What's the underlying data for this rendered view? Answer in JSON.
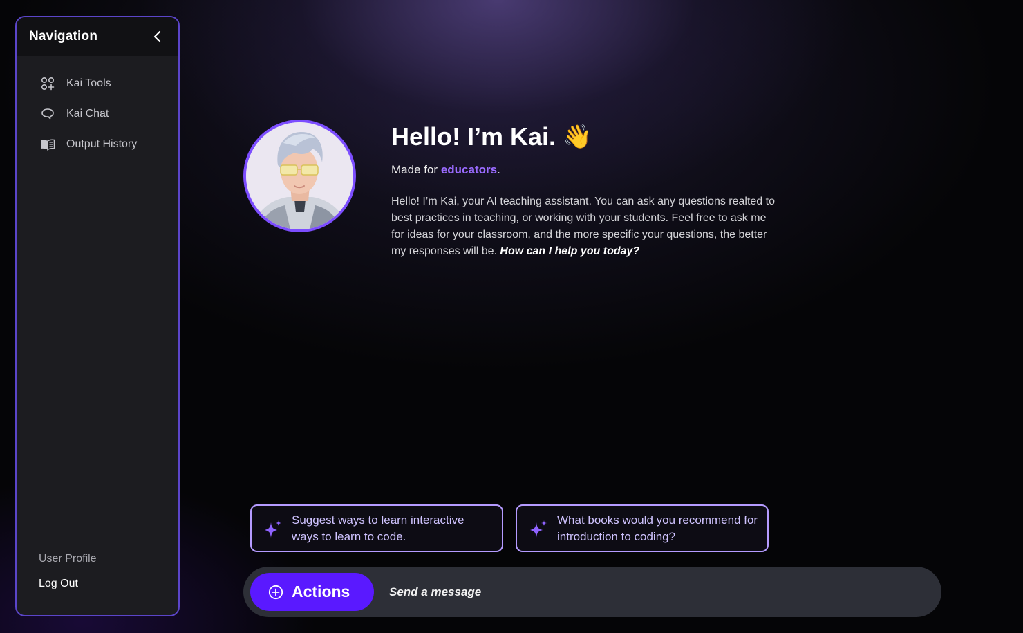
{
  "nav": {
    "title": "Navigation",
    "items": [
      {
        "label": "Kai Tools",
        "icon": "grid-plus-icon"
      },
      {
        "label": "Kai Chat",
        "icon": "chat-bubble-icon"
      },
      {
        "label": "Output History",
        "icon": "open-book-icon"
      }
    ],
    "footer": {
      "user_profile": "User Profile",
      "log_out": "Log Out"
    }
  },
  "intro": {
    "greeting": "Hello! I’m Kai.",
    "wave": "👋",
    "made_for_prefix": "Made for ",
    "made_for_accent": "educators",
    "made_for_suffix": ".",
    "body": "Hello! I’m Kai, your AI teaching assistant. You can ask any questions realted to best practices in teaching, or working with your students. Feel free to ask me for ideas for your classroom, and the more specific your questions, the better my responses will be. ",
    "question": "How can I help you today?"
  },
  "suggestions": [
    {
      "text": "Suggest ways to learn interactive ways to learn to code."
    },
    {
      "text": "What books would you recommend for introduction to coding?"
    }
  ],
  "chat": {
    "actions_label": "Actions",
    "placeholder": "Send a message"
  },
  "colors": {
    "accent": "#7c4dff",
    "actions_button": "#5a19ff",
    "suggestion_border": "#b59bff"
  }
}
